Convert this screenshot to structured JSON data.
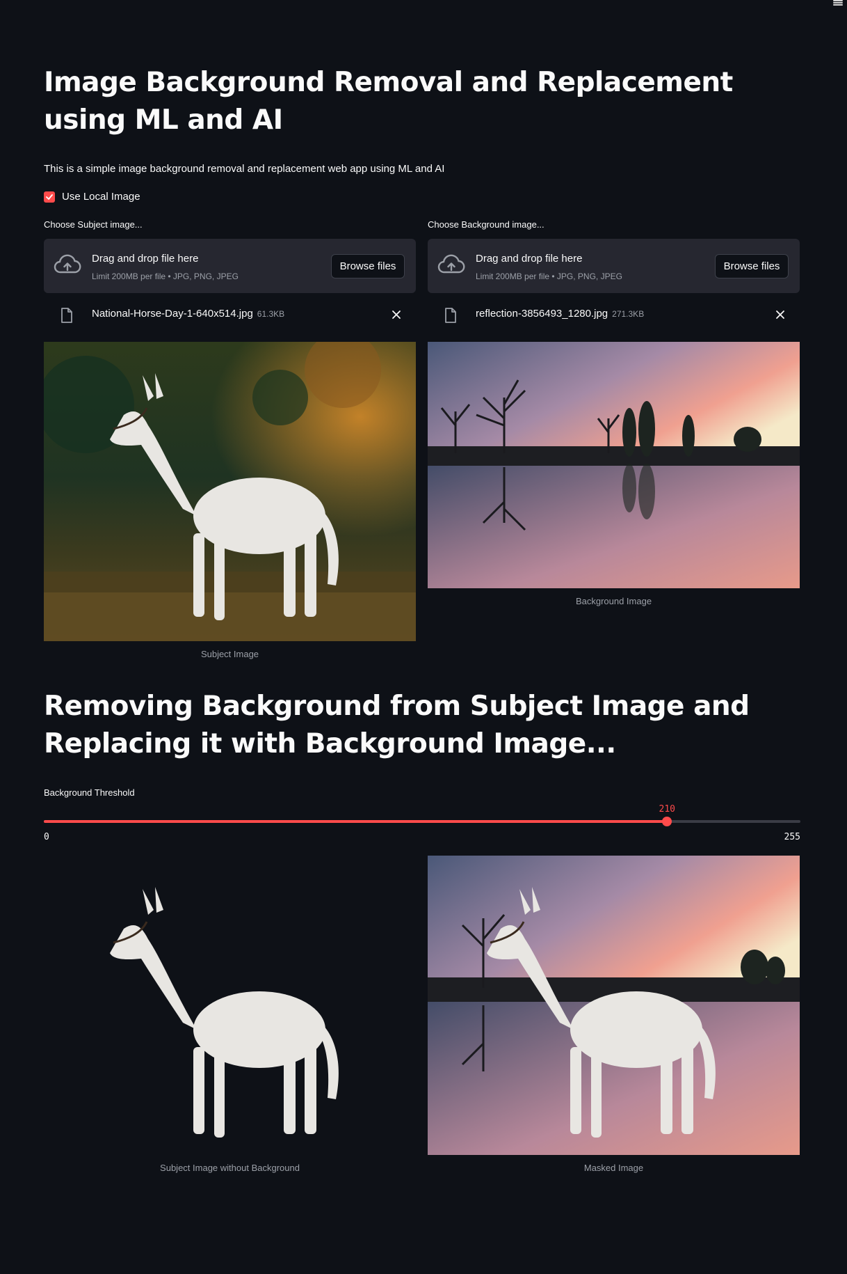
{
  "page": {
    "title": "Image Background Removal and Replacement using ML and AI",
    "intro": "This is a simple image background removal and replacement web app using ML and AI"
  },
  "checkbox": {
    "label": "Use Local Image",
    "checked": true
  },
  "uploaders": {
    "subject": {
      "label": "Choose Subject image...",
      "drop_title": "Drag and drop file here",
      "drop_sub": "Limit 200MB per file • JPG, PNG, JPEG",
      "button": "Browse files",
      "file_name": "National-Horse-Day-1-640x514.jpg",
      "file_size": "61.3KB"
    },
    "background": {
      "label": "Choose Background image...",
      "drop_title": "Drag and drop file here",
      "drop_sub": "Limit 200MB per file • JPG, PNG, JPEG",
      "button": "Browse files",
      "file_name": "reflection-3856493_1280.jpg",
      "file_size": "271.3KB"
    }
  },
  "images": {
    "subject_caption": "Subject Image",
    "background_caption": "Background Image",
    "no_bg_caption": "Subject Image without Background",
    "masked_caption": "Masked Image"
  },
  "section": {
    "title": "Removing Background from Subject Image and Replacing it with Background Image..."
  },
  "slider": {
    "label": "Background Threshold",
    "value": 210,
    "min": 0,
    "max": 255,
    "value_text": "210",
    "min_text": "0",
    "max_text": "255"
  },
  "colors": {
    "accent": "#ff4b4b",
    "background": "#0e1117",
    "surface": "#262730"
  }
}
